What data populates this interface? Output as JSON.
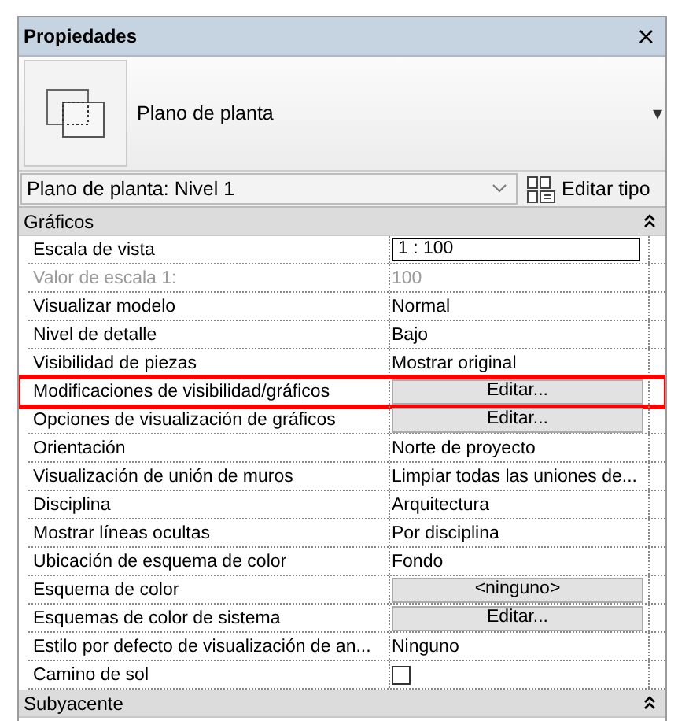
{
  "panel": {
    "title": "Propiedades",
    "close": "×"
  },
  "type_selector": {
    "name": "Plano de planta",
    "dropdown": "▾"
  },
  "instance": {
    "value": "Plano de planta: Nivel 1",
    "edit_type": "Editar tipo"
  },
  "groups": [
    {
      "title": "Gráficos",
      "expanded": true,
      "rows": [
        {
          "kind": "field",
          "label": "Escala de vista",
          "value": "1 : 100",
          "highlighted": false
        },
        {
          "kind": "disabled",
          "label": "Valor de escala    1:",
          "value": "100",
          "highlighted": false
        },
        {
          "kind": "text",
          "label": "Visualizar modelo",
          "value": "Normal",
          "highlighted": false
        },
        {
          "kind": "text",
          "label": "Nivel de detalle",
          "value": "Bajo",
          "highlighted": false
        },
        {
          "kind": "text",
          "label": "Visibilidad de piezas",
          "value": "Mostrar original",
          "highlighted": false
        },
        {
          "kind": "button",
          "label": "Modificaciones de visibilidad/gráficos",
          "value": "Editar...",
          "highlighted": true
        },
        {
          "kind": "button",
          "label": "Opciones de visualización de gráficos",
          "value": "Editar...",
          "highlighted": false
        },
        {
          "kind": "text",
          "label": "Orientación",
          "value": "Norte de proyecto",
          "highlighted": false
        },
        {
          "kind": "text",
          "label": "Visualización de unión de muros",
          "value": "Limpiar todas las uniones de...",
          "highlighted": false
        },
        {
          "kind": "text",
          "label": "Disciplina",
          "value": "Arquitectura",
          "highlighted": false
        },
        {
          "kind": "text",
          "label": "Mostrar líneas ocultas",
          "value": "Por disciplina",
          "highlighted": false
        },
        {
          "kind": "text",
          "label": "Ubicación de esquema de color",
          "value": "Fondo",
          "highlighted": false
        },
        {
          "kind": "button",
          "label": "Esquema de color",
          "value": "<ninguno>",
          "highlighted": false
        },
        {
          "kind": "button",
          "label": "Esquemas de color de sistema",
          "value": "Editar...",
          "highlighted": false
        },
        {
          "kind": "text",
          "label": "Estilo por defecto de visualización de an...",
          "value": "Ninguno",
          "highlighted": false
        },
        {
          "kind": "checkbox",
          "label": "Camino de sol",
          "checked": false,
          "highlighted": false
        }
      ]
    },
    {
      "title": "Subyacente",
      "expanded": true
    }
  ]
}
